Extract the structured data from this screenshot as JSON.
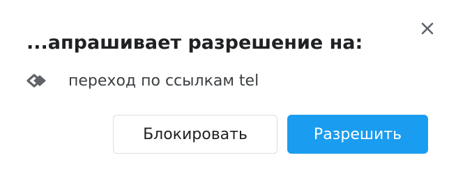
{
  "dialog": {
    "title": "...апрашивает разрешение на:",
    "close_icon": "close-icon",
    "permission": {
      "icon": "link-diamond-icon",
      "label": "переход по ссылкам tel"
    },
    "buttons": {
      "block_label": "Блокировать",
      "allow_label": "Разрешить"
    }
  },
  "colors": {
    "accent": "#1a9cf0",
    "title_text": "#202124",
    "body_text": "#3c4043",
    "border": "#dadce0"
  }
}
